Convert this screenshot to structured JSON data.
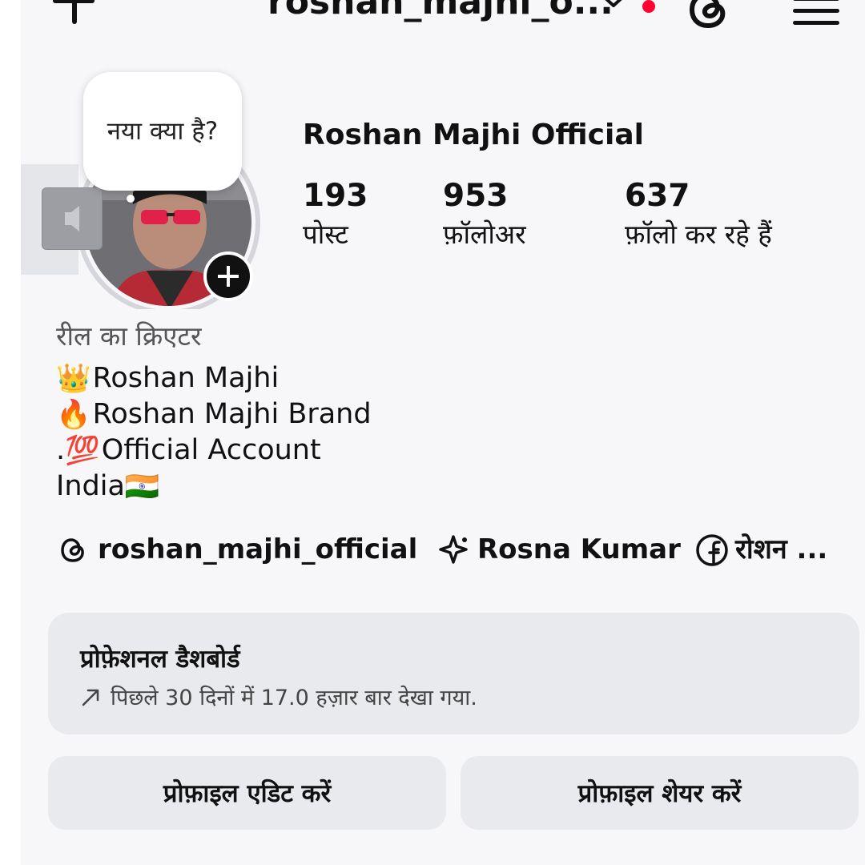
{
  "header": {
    "username": "roshan_majhi_o...",
    "icons": [
      "plus-icon",
      "chevron-down-icon",
      "notification-dot",
      "threads-icon",
      "menu-icon"
    ]
  },
  "story": {
    "note_bubble": "नया क्या है?"
  },
  "profile": {
    "display_name": "Roshan Majhi Official",
    "stats": [
      {
        "value": "193",
        "label": "पोस्ट"
      },
      {
        "value": "953",
        "label": "फ़ॉलोअर"
      },
      {
        "value": "637",
        "label": "फ़ॉलो कर रहे हैं"
      }
    ]
  },
  "bio": {
    "category": "रील का क्रिएटर",
    "lines": [
      {
        "emoji": "👑",
        "text": "Roshan Majhi"
      },
      {
        "emoji": "🔥",
        "text": "Roshan Majhi Brand"
      },
      {
        "prefix": ".",
        "emoji": "💯",
        "text": "Official Account"
      },
      {
        "text": "India",
        "emoji_after": "🇮🇳"
      }
    ]
  },
  "links": [
    {
      "icon": "threads-icon",
      "text": "roshan_majhi_official"
    },
    {
      "icon": "sparkle-icon",
      "text": "Rosna Kumar"
    },
    {
      "icon": "facebook-icon",
      "text": "रोशन ..."
    }
  ],
  "dashboard": {
    "title": "प्रोफ़ेशनल डैशबोर्ड",
    "subtitle": "पिछले 30 दिनों में 17.0 हज़ार बार देखा गया.",
    "icon": "trend-arrow-icon"
  },
  "actions": {
    "edit_profile": "प्रोफ़ाइल एडिट करें",
    "share_profile": "प्रोफ़ाइल शेयर करें"
  },
  "colors": {
    "background": "#f7f7f9",
    "card": "#e9eaee",
    "notification": "#ff0033",
    "text": "#111111"
  }
}
